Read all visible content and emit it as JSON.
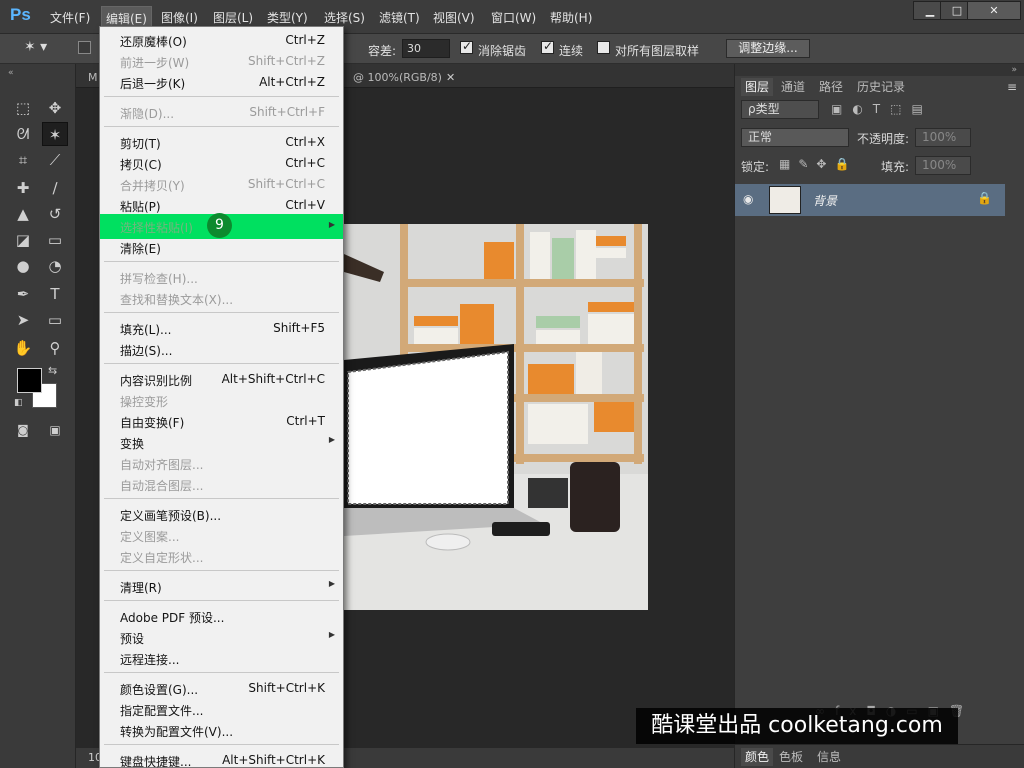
{
  "app": {
    "logo": "Ps"
  },
  "menubar": {
    "items": [
      "文件(F)",
      "编辑(E)",
      "图像(I)",
      "图层(L)",
      "类型(Y)",
      "选择(S)",
      "滤镜(T)",
      "视图(V)",
      "窗口(W)",
      "帮助(H)"
    ],
    "window_buttons": [
      "▁",
      "□",
      "✕"
    ]
  },
  "options": {
    "tolerance_label": "容差:",
    "tolerance_value": "30",
    "antialias_label": "消除锯齿",
    "contiguous_label": "连续",
    "all_layers_label": "对所有图层取样",
    "refine_edge_label": "调整边缘..."
  },
  "document": {
    "tab_partial": "M",
    "tab_suffix": "@ 100%(RGB/8)",
    "status_zoom": "10"
  },
  "edit_menu": {
    "items": [
      {
        "label": "还原魔棒(O)",
        "shortcut": "Ctrl+Z",
        "disabled": false
      },
      {
        "label": "前进一步(W)",
        "shortcut": "Shift+Ctrl+Z",
        "disabled": true
      },
      {
        "label": "后退一步(K)",
        "shortcut": "Alt+Ctrl+Z",
        "disabled": false
      },
      {
        "label": "渐隐(D)...",
        "shortcut": "Shift+Ctrl+F",
        "disabled": true
      },
      {
        "label": "剪切(T)",
        "shortcut": "Ctrl+X",
        "disabled": false
      },
      {
        "label": "拷贝(C)",
        "shortcut": "Ctrl+C",
        "disabled": false
      },
      {
        "label": "合并拷贝(Y)",
        "shortcut": "Shift+Ctrl+C",
        "disabled": true
      },
      {
        "label": "粘贴(P)",
        "shortcut": "Ctrl+V",
        "disabled": false
      },
      {
        "label": "选择性粘贴(I)",
        "shortcut": "",
        "disabled": true,
        "highlighted": true,
        "submenu": true
      },
      {
        "label": "清除(E)",
        "shortcut": "",
        "disabled": false
      },
      {
        "label": "拼写检查(H)...",
        "shortcut": "",
        "disabled": true
      },
      {
        "label": "查找和替换文本(X)...",
        "shortcut": "",
        "disabled": true
      },
      {
        "label": "填充(L)...",
        "shortcut": "Shift+F5",
        "disabled": false
      },
      {
        "label": "描边(S)...",
        "shortcut": "",
        "disabled": false
      },
      {
        "label": "内容识别比例",
        "shortcut": "Alt+Shift+Ctrl+C",
        "disabled": false
      },
      {
        "label": "操控变形",
        "shortcut": "",
        "disabled": true
      },
      {
        "label": "自由变换(F)",
        "shortcut": "Ctrl+T",
        "disabled": false
      },
      {
        "label": "变换",
        "shortcut": "",
        "disabled": false,
        "submenu": true
      },
      {
        "label": "自动对齐图层...",
        "shortcut": "",
        "disabled": true
      },
      {
        "label": "自动混合图层...",
        "shortcut": "",
        "disabled": true
      },
      {
        "label": "定义画笔预设(B)...",
        "shortcut": "",
        "disabled": false
      },
      {
        "label": "定义图案...",
        "shortcut": "",
        "disabled": true
      },
      {
        "label": "定义自定形状...",
        "shortcut": "",
        "disabled": true
      },
      {
        "label": "清理(R)",
        "shortcut": "",
        "disabled": false,
        "submenu": true
      },
      {
        "label": "Adobe PDF 预设...",
        "shortcut": "",
        "disabled": false
      },
      {
        "label": "预设",
        "shortcut": "",
        "disabled": false,
        "submenu": true
      },
      {
        "label": "远程连接...",
        "shortcut": "",
        "disabled": false
      },
      {
        "label": "颜色设置(G)...",
        "shortcut": "Shift+Ctrl+K",
        "disabled": false
      },
      {
        "label": "指定配置文件...",
        "shortcut": "",
        "disabled": false
      },
      {
        "label": "转换为配置文件(V)...",
        "shortcut": "",
        "disabled": false
      },
      {
        "label": "键盘快捷键...",
        "shortcut": "Alt+Shift+Ctrl+K",
        "disabled": false
      }
    ],
    "step_badge": "9"
  },
  "layers_panel": {
    "tabs": [
      "图层",
      "通道",
      "路径",
      "历史记录"
    ],
    "filter_label": "ρ类型",
    "blend_mode": "正常",
    "opacity_label": "不透明度:",
    "opacity_value": "100%",
    "lock_label": "锁定:",
    "fill_label": "填充:",
    "fill_value": "100%",
    "layer_name": "背景"
  },
  "bottom_panel": {
    "tabs": [
      "颜色",
      "色板",
      "信息"
    ]
  },
  "watermark": "酷课堂出品 coolketang.com"
}
